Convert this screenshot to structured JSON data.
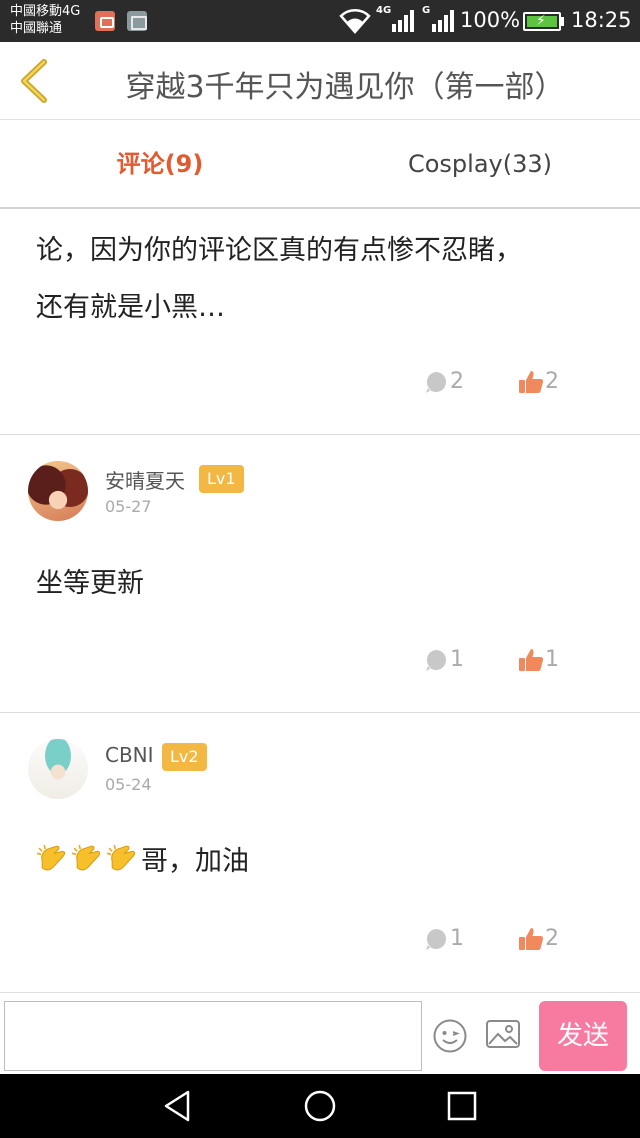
{
  "status_bar": {
    "carrier_line1": "中國移動4G",
    "carrier_line2": "中國聯通",
    "network1": "4G",
    "network2": "G",
    "battery": "100%",
    "time": "18:25",
    "colors": {
      "background": "#2b2b2b",
      "battery_fill": "#5cc43e"
    }
  },
  "header": {
    "back_icon": "chevron-left-icon",
    "title": "穿越3千年只为遇见你（第一部）"
  },
  "tabs": [
    {
      "label": "评论(9)",
      "active": true
    },
    {
      "label": "Cosplay(33)",
      "active": false
    }
  ],
  "comments": [
    {
      "text_line1": "论，因为你的评论区真的有点惨不忍睹，",
      "text_line2": "还有就是小黑…",
      "replies": "2",
      "likes": "2"
    },
    {
      "username": "安晴夏天",
      "level": "Lv1",
      "date": "05-27",
      "text": "坐等更新",
      "replies": "1",
      "likes": "1"
    },
    {
      "username": "CBNI",
      "level": "Lv2",
      "date": "05-24",
      "emoji": "clapping-hands x3",
      "text": "哥，加油",
      "replies": "1",
      "likes": "2"
    }
  ],
  "input_bar": {
    "placeholder": "",
    "emoji_icon": "smiley-icon",
    "image_icon": "image-icon",
    "send_label": "发送"
  },
  "colors": {
    "active_tab": "#e45a2f",
    "level_badge": "#f3b743",
    "like_icon": "#f08a5d",
    "send_button": "#f77ba0"
  }
}
